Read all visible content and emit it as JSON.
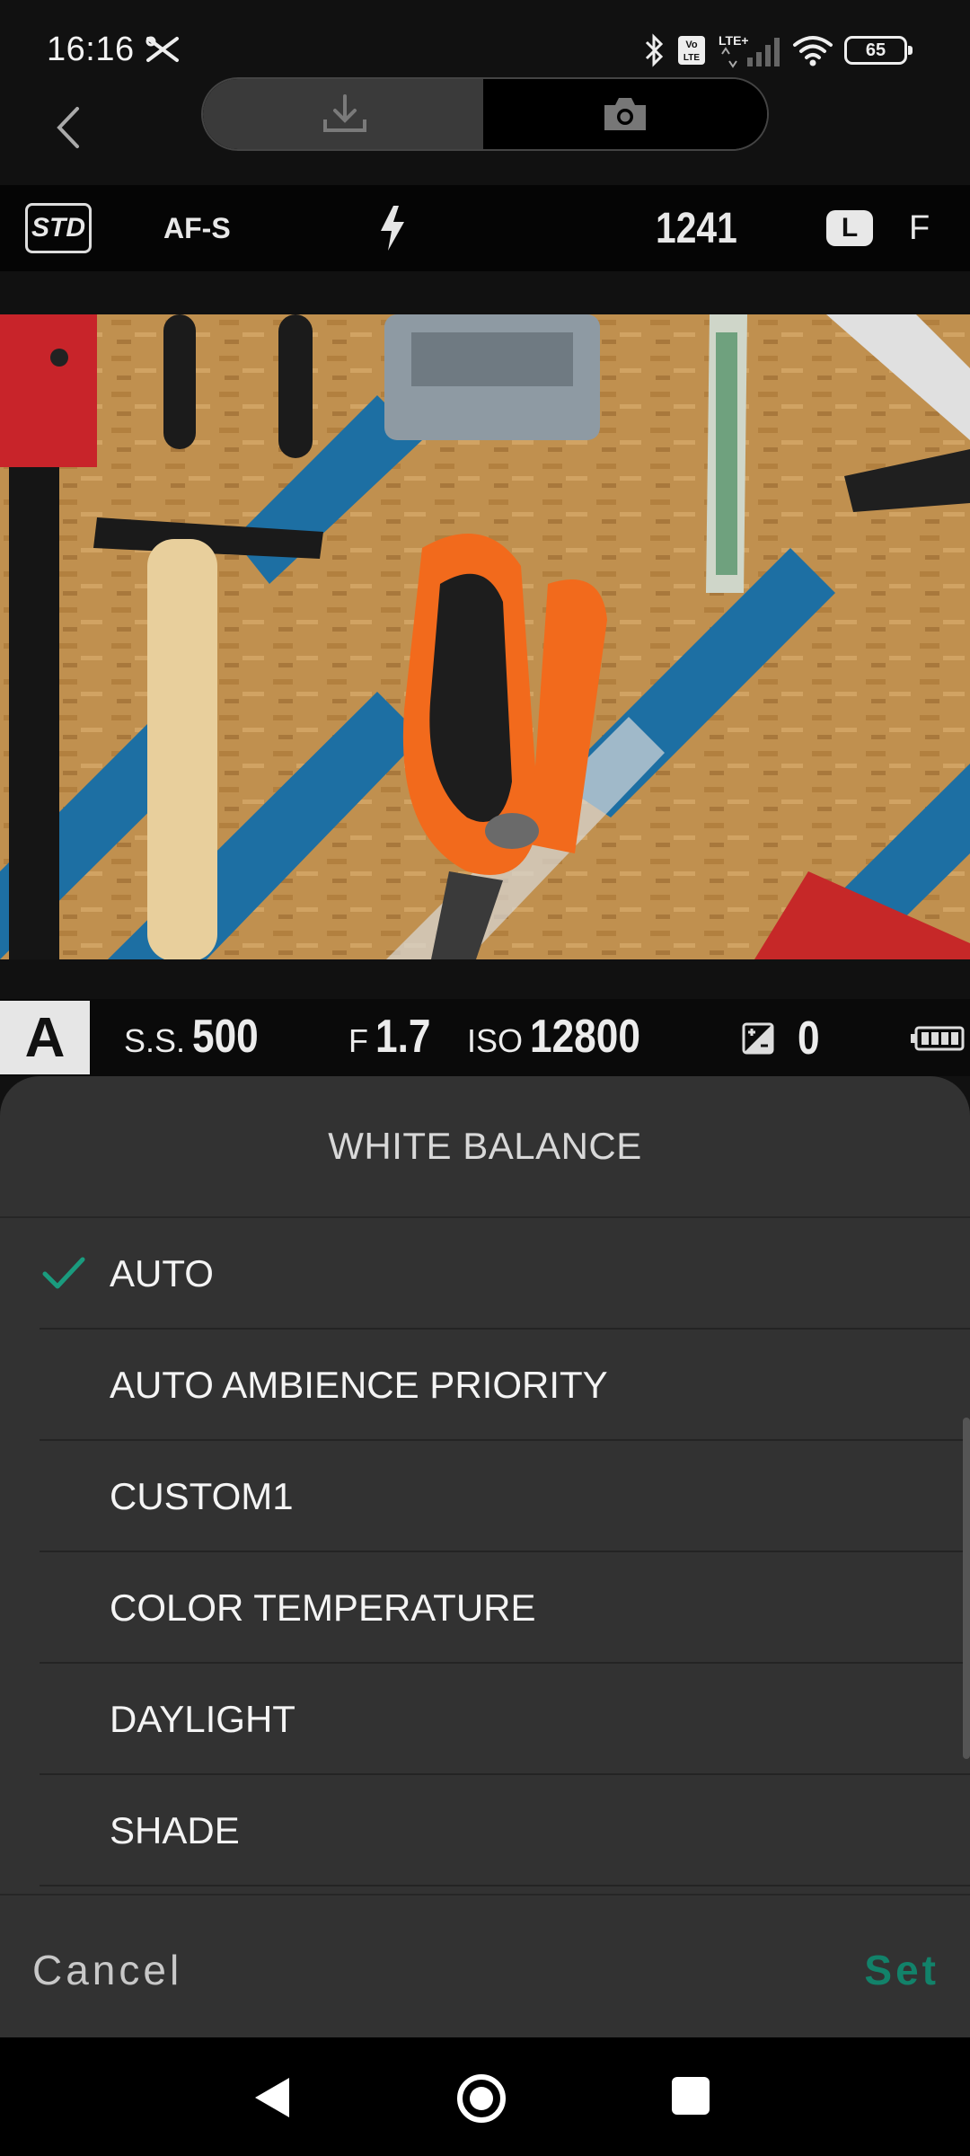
{
  "status_bar": {
    "time": "16:16",
    "network": "LTE+",
    "volte": "Vo LTE",
    "battery": "65"
  },
  "top_nav": {
    "tabs": [
      {
        "icon": "download-icon",
        "active": false
      },
      {
        "icon": "camera-icon",
        "active": true
      }
    ]
  },
  "camera_info": {
    "film_sim": "STD",
    "focus_mode": "AF-S",
    "flash": "flash-icon",
    "shots_remaining": "1241",
    "image_size": "L",
    "image_quality": "F"
  },
  "exposure": {
    "mode": "A",
    "shutter_label": "S.S.",
    "shutter_value": "500",
    "aperture_label": "F",
    "aperture_value": "1.7",
    "iso_label": "ISO",
    "iso_value": "12800",
    "ev_value": "0"
  },
  "white_balance_sheet": {
    "title": "WHITE BALANCE",
    "options": [
      {
        "label": "AUTO",
        "selected": true
      },
      {
        "label": "AUTO AMBIENCE PRIORITY",
        "selected": false
      },
      {
        "label": "CUSTOM1",
        "selected": false
      },
      {
        "label": "COLOR TEMPERATURE",
        "selected": false
      },
      {
        "label": "DAYLIGHT",
        "selected": false
      },
      {
        "label": "SHADE",
        "selected": false
      }
    ],
    "cancel_label": "Cancel",
    "set_label": "Set"
  },
  "colors": {
    "accent": "#12826a",
    "sheet_bg": "#323232"
  }
}
